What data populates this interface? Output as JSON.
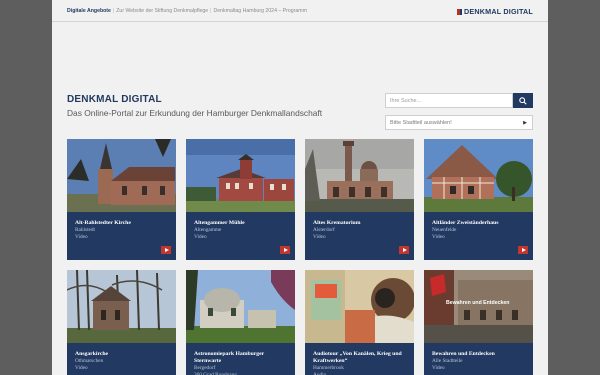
{
  "topnav": {
    "items": [
      "Digitale Angebote",
      "Zur Website der Stiftung Denkmalpflege",
      "Denkmaltag Hamburg 2024 – Programm"
    ],
    "separator": "|"
  },
  "logo": {
    "text": "DENKMAL DIGITAL"
  },
  "header": {
    "title": "DENKMAL DIGITAL",
    "subtitle": "Das Online-Portal zur Erkundung der Hamburger Denkmallandschaft"
  },
  "search": {
    "placeholder": "Ihre Suche...",
    "icon": "search-icon"
  },
  "district": {
    "label": "Bitte Stadtteil auswählen!",
    "icon": "chevron-right-icon"
  },
  "cards": [
    {
      "title": "Alt-Rahlstedter Kirche",
      "district": "Rahlstedt",
      "type": "Video",
      "icon": "play-icon"
    },
    {
      "title": "Altengammer Mühle",
      "district": "Altengamme",
      "type": "Video",
      "icon": "play-icon"
    },
    {
      "title": "Altes Krematorium",
      "district": "Alsterdorf",
      "type": "Video",
      "icon": "play-icon"
    },
    {
      "title": "Altländer Zweiständerhaus",
      "district": "Neuenfelde",
      "type": "Video",
      "icon": "play-icon"
    },
    {
      "title": "Ansgarkirche",
      "district": "Othmarschen",
      "type": "Video"
    },
    {
      "title": "Astronomiepark Hamburger Sternwarte",
      "district": "Bergedorf",
      "type": "360 Grad Rundgang"
    },
    {
      "title": "Audiotour „Von Kanälen, Krieg und Kraftwerken“",
      "district": "Hammerbrook",
      "type": "Audio"
    },
    {
      "title": "Bewahren und Entdecken",
      "district": "Alle Stadtteile",
      "type": "Video",
      "overlay": "Bewahren und Entdecken"
    }
  ],
  "colors": {
    "brand": "#223a62",
    "accent": "#c2362f",
    "background": "#f1f1f1"
  }
}
